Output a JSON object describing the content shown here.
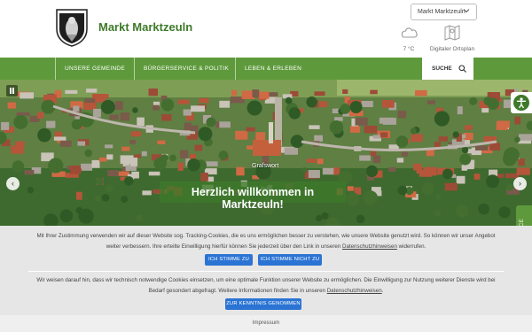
{
  "site": {
    "title": "Markt Marktzeuln",
    "crest_icon": "coat-of-arms-icon"
  },
  "language": {
    "selected": "Markt Marktzeuln"
  },
  "weather": {
    "temperature": "7 °C",
    "icon": "cloud-icon"
  },
  "map": {
    "label": "Digitaler Ortsplan",
    "icon": "map-icon"
  },
  "nav": {
    "items": [
      {
        "label": "UNSERE GEMEINDE"
      },
      {
        "label": "BÜRGERSERVICE & POLITIK"
      },
      {
        "label": "LEBEN & ERLEBEN"
      }
    ],
    "search_label": "SUCHE"
  },
  "hero": {
    "caption": "Grafswort",
    "welcome": "Herzlich willkommen in Marktzeuln!",
    "prev": "‹",
    "next": "›"
  },
  "service_tab": {
    "label": "SERVICE"
  },
  "cookie": {
    "text1_a": "Mit Ihrer Zustimmung verwenden wir auf dieser Website sog. Tracking-Cookies, die es uns ermöglichen besser zu verstehen, wie unsere Website genutzt wird. So können wir unser Angebot weiter verbessern. Ihre erteilte Einwilligung hierfür können Sie jederzeit über den Link in unseren ",
    "text1_link": "Datenschutzhinweisen",
    "text1_b": " widerrufen.",
    "accept_label": "ICH STIMME ZU",
    "decline_label": "ICH STIMME NICHT ZU",
    "text2_a": "Wir weisen darauf hin, dass wir technisch notwendige Cookies einsetzen, um eine optimale Funktion unserer Website zu ermöglichen. Die Einwilligung zur Nutzung weiterer Dienste wird bei Bedarf gesondert abgefragt. Weitere Informationen finden Sie in unseren ",
    "text2_link": "Datenschutzhinweisen",
    "text2_b": ".",
    "acknowledge_label": "ZUR KENNTNIS GENOMMEN"
  },
  "footer": {
    "impressum": "Impressum"
  },
  "colors": {
    "brand_green": "#5e9a3c",
    "title_green": "#3e7a2a",
    "button_blue": "#2b74d4"
  }
}
